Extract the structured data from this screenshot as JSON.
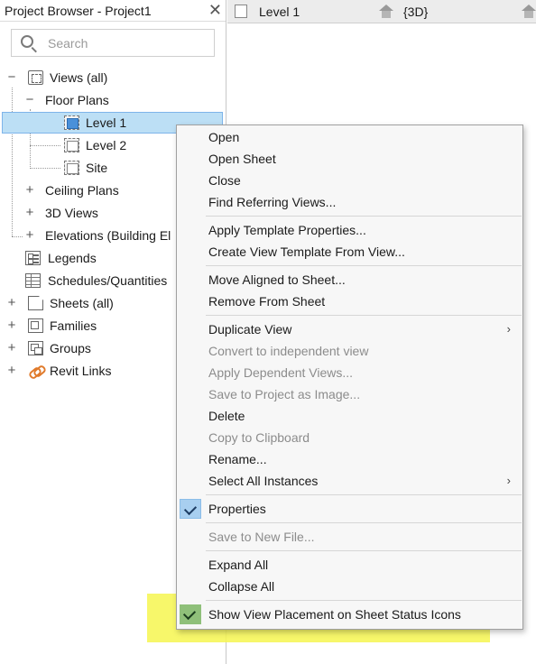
{
  "browser": {
    "title": "Project Browser - Project1",
    "close_glyph": "✕",
    "search_placeholder": "Search"
  },
  "tree": {
    "views_all": "Views (all)",
    "floor_plans": "Floor Plans",
    "level1": "Level 1",
    "level2": "Level 2",
    "site": "Site",
    "ceiling_plans": "Ceiling Plans",
    "views_3d": "3D Views",
    "elevations": "Elevations (Building El",
    "legends": "Legends",
    "schedules": "Schedules/Quantities",
    "sheets": "Sheets (all)",
    "families": "Families",
    "groups": "Groups",
    "revit_links": "Revit Links",
    "expand": "+",
    "collapse": "−"
  },
  "tabs": {
    "tab1": "Level 1",
    "tab2": "{3D}"
  },
  "menu": {
    "open": "Open",
    "open_sheet": "Open Sheet",
    "close": "Close",
    "find_referring": "Find Referring Views...",
    "apply_template": "Apply Template Properties...",
    "create_template": "Create View Template From View...",
    "move_aligned": "Move Aligned to Sheet...",
    "remove_from_sheet": "Remove From Sheet",
    "duplicate_view": "Duplicate View",
    "convert_independent": "Convert to independent view",
    "apply_dependent": "Apply Dependent Views...",
    "save_image": "Save to Project as Image...",
    "delete": "Delete",
    "copy_clipboard": "Copy to Clipboard",
    "rename": "Rename...",
    "select_all": "Select All Instances",
    "properties": "Properties",
    "save_new_file": "Save to New File...",
    "expand_all": "Expand All",
    "collapse_all": "Collapse All",
    "show_placement": "Show View Placement on Sheet Status Icons",
    "submenu_arrow": "›"
  },
  "colors": {
    "selection": "#bcdff5",
    "highlight_yellow": "#f6f650",
    "check_green": "#8fc07a",
    "check_blue": "#a8cff0",
    "link_orange": "#e07a2b"
  }
}
